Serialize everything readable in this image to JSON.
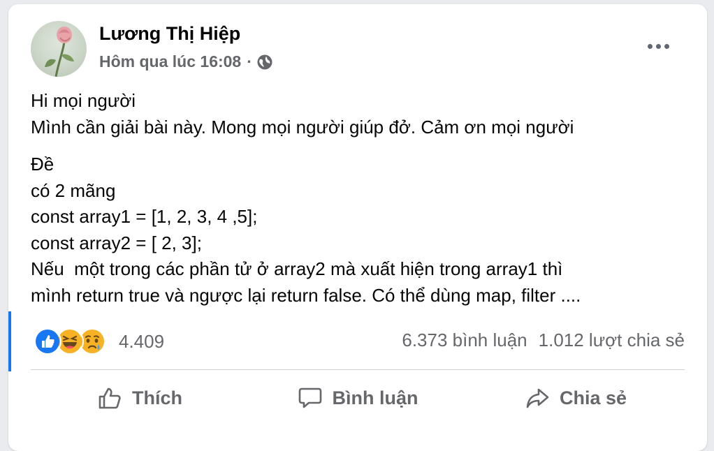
{
  "post": {
    "author": "Lương Thị Hiệp",
    "timestamp": "Hôm qua lúc 16:08",
    "separator": "·",
    "privacy_icon": "globe-icon",
    "more_icon": "more-horizontal-icon",
    "body_lines": [
      "Hi mọi người",
      "Mình cần giải bài này. Mong mọi người giúp đở. Cảm ơn mọi người"
    ],
    "body_lines_2": [
      "Đề",
      "có 2 mãng",
      "const array1 = [1, 2, 3, 4 ,5];",
      "const array2 = [ 2, 3];",
      "Nếu  một trong các phần tử ở array2 mà xuất hiện trong array1 thì",
      "mình return true và ngược lại return false. Có thể dùng map, filter ...."
    ]
  },
  "reactions": {
    "icons": [
      "like-reaction-icon",
      "haha-reaction-icon",
      "sad-reaction-icon"
    ],
    "count": "4.409"
  },
  "stats": {
    "comments": "6.373 bình luận",
    "shares": "1.012 lượt chia sẻ"
  },
  "actions": {
    "like": "Thích",
    "comment": "Bình luận",
    "share": "Chia sẻ"
  },
  "colors": {
    "accent": "#1877f2",
    "secondary_text": "#65676b",
    "primary_text": "#050505"
  }
}
